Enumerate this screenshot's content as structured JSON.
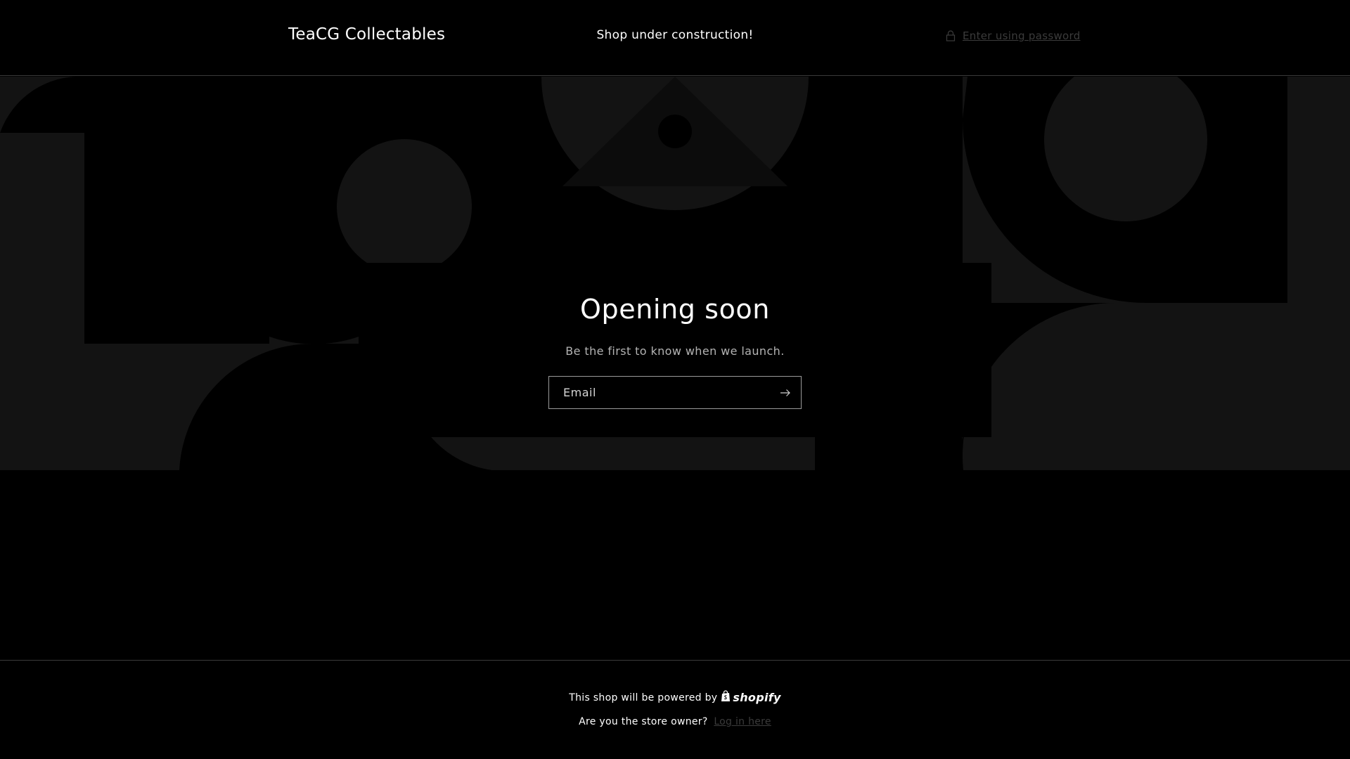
{
  "header": {
    "logo": "TeaCG Collectables",
    "announcement": "Shop under construction!",
    "password_link": "Enter using password"
  },
  "newsletter": {
    "title": "Opening soon",
    "subtitle": "Be the first to know when we launch.",
    "email_placeholder": "Email"
  },
  "footer": {
    "powered_by": "This shop will be powered by",
    "shopify": "shopify",
    "owner_question": "Are you the store owner?",
    "login_link": "Log in here"
  },
  "icons": {
    "lock": "lock-icon",
    "submit": "arrow-right-icon",
    "shopify_bag": "shopify-bag-icon"
  },
  "colors": {
    "background": "#000000",
    "pattern": "#131313",
    "muted_link": "#3b3b3b",
    "text": "#ffffff"
  }
}
